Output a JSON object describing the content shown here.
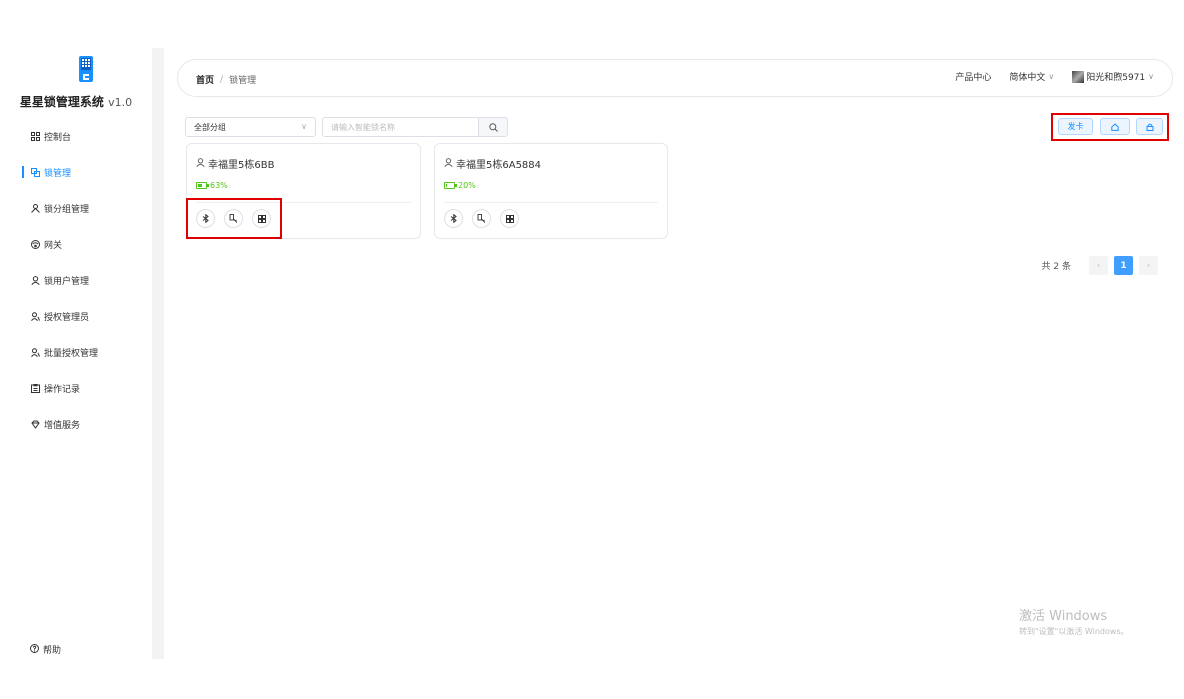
{
  "app": {
    "title": "星星锁管理系统",
    "version": "v1.0",
    "brand_color": "#1890ff"
  },
  "sidebar": {
    "items": [
      {
        "label": "控制台",
        "icon": "dashboard-icon",
        "active": false
      },
      {
        "label": "锁管理",
        "icon": "lock-manage-icon",
        "active": true
      },
      {
        "label": "锁分组管理",
        "icon": "group-icon",
        "active": false
      },
      {
        "label": "网关",
        "icon": "gateway-icon",
        "active": false
      },
      {
        "label": "锁用户管理",
        "icon": "user-icon",
        "active": false
      },
      {
        "label": "授权管理员",
        "icon": "admin-user-icon",
        "active": false
      },
      {
        "label": "批量授权管理",
        "icon": "batch-user-icon",
        "active": false
      },
      {
        "label": "操作记录",
        "icon": "clipboard-icon",
        "active": false
      },
      {
        "label": "增值服务",
        "icon": "diamond-icon",
        "active": false
      }
    ],
    "help": "帮助"
  },
  "header": {
    "breadcrumb_home": "首页",
    "breadcrumb_sep": "/",
    "breadcrumb_current": "锁管理",
    "product_center": "产品中心",
    "language": "简体中文",
    "username": "阳光和煦5971"
  },
  "filters": {
    "group_select": "全部分组",
    "search_placeholder": "请输入智能锁名称"
  },
  "actions": {
    "issue_card": "发卡",
    "home_icon": "home-icon",
    "lock_icon": "lock-icon"
  },
  "locks": [
    {
      "name": "幸福里5栋6BB",
      "battery": "63%",
      "battery_level": 0.63
    },
    {
      "name": "幸福里5栋6A5884",
      "battery": "20%",
      "battery_level": 0.2
    }
  ],
  "pagination": {
    "total": "共 2 条",
    "prev": "‹",
    "current": "1",
    "next": "›"
  },
  "watermark": {
    "line1": "激活 Windows",
    "line2": "转到\"设置\"以激活 Windows。"
  }
}
